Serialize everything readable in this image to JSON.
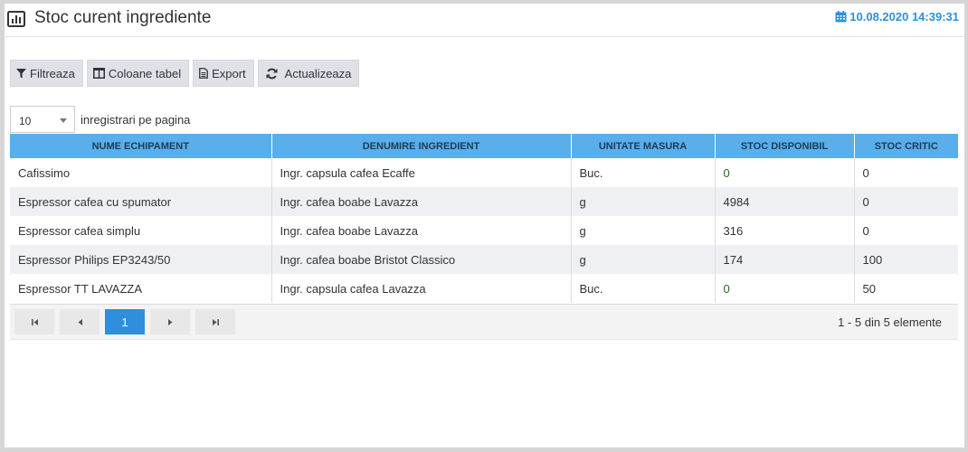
{
  "header": {
    "title": "Stoc curent ingrediente",
    "datetime": "10.08.2020 14:39:31",
    "accent_color": "#2f8fdd",
    "title_icon": "bar-chart-icon",
    "datetime_icon": "calendar-icon"
  },
  "toolbar": {
    "filter_label": "Filtreaza",
    "columns_label": "Coloane tabel",
    "export_label": "Export",
    "refresh_label": "Actualizeaza"
  },
  "page_size": {
    "value": "10",
    "label": "inregistrari pe pagina"
  },
  "table": {
    "columns": [
      "NUME ECHIPAMENT",
      "DENUMIRE INGREDIENT",
      "UNITATE MASURA",
      "STOC DISPONIBIL",
      "STOC CRITIC"
    ],
    "rows": [
      [
        "Cafissimo",
        "Ingr. capsula cafea Ecaffe",
        "Buc.",
        "0",
        "0"
      ],
      [
        "Espressor cafea cu spumator",
        "Ingr. cafea boabe Lavazza",
        "g",
        "4984",
        "0"
      ],
      [
        "Espressor cafea simplu",
        "Ingr. cafea boabe Lavazza",
        "g",
        "316",
        "0"
      ],
      [
        "Espressor Philips EP3243/50",
        "Ingr. cafea boabe Bristot Classico",
        "g",
        "174",
        "100"
      ],
      [
        "Espressor TT LAVAZZA",
        "Ingr. capsula cafea Lavazza",
        "Buc.",
        "0",
        "50"
      ]
    ]
  },
  "pagination": {
    "current_page": "1",
    "info": "1 - 5 din 5 elemente"
  }
}
